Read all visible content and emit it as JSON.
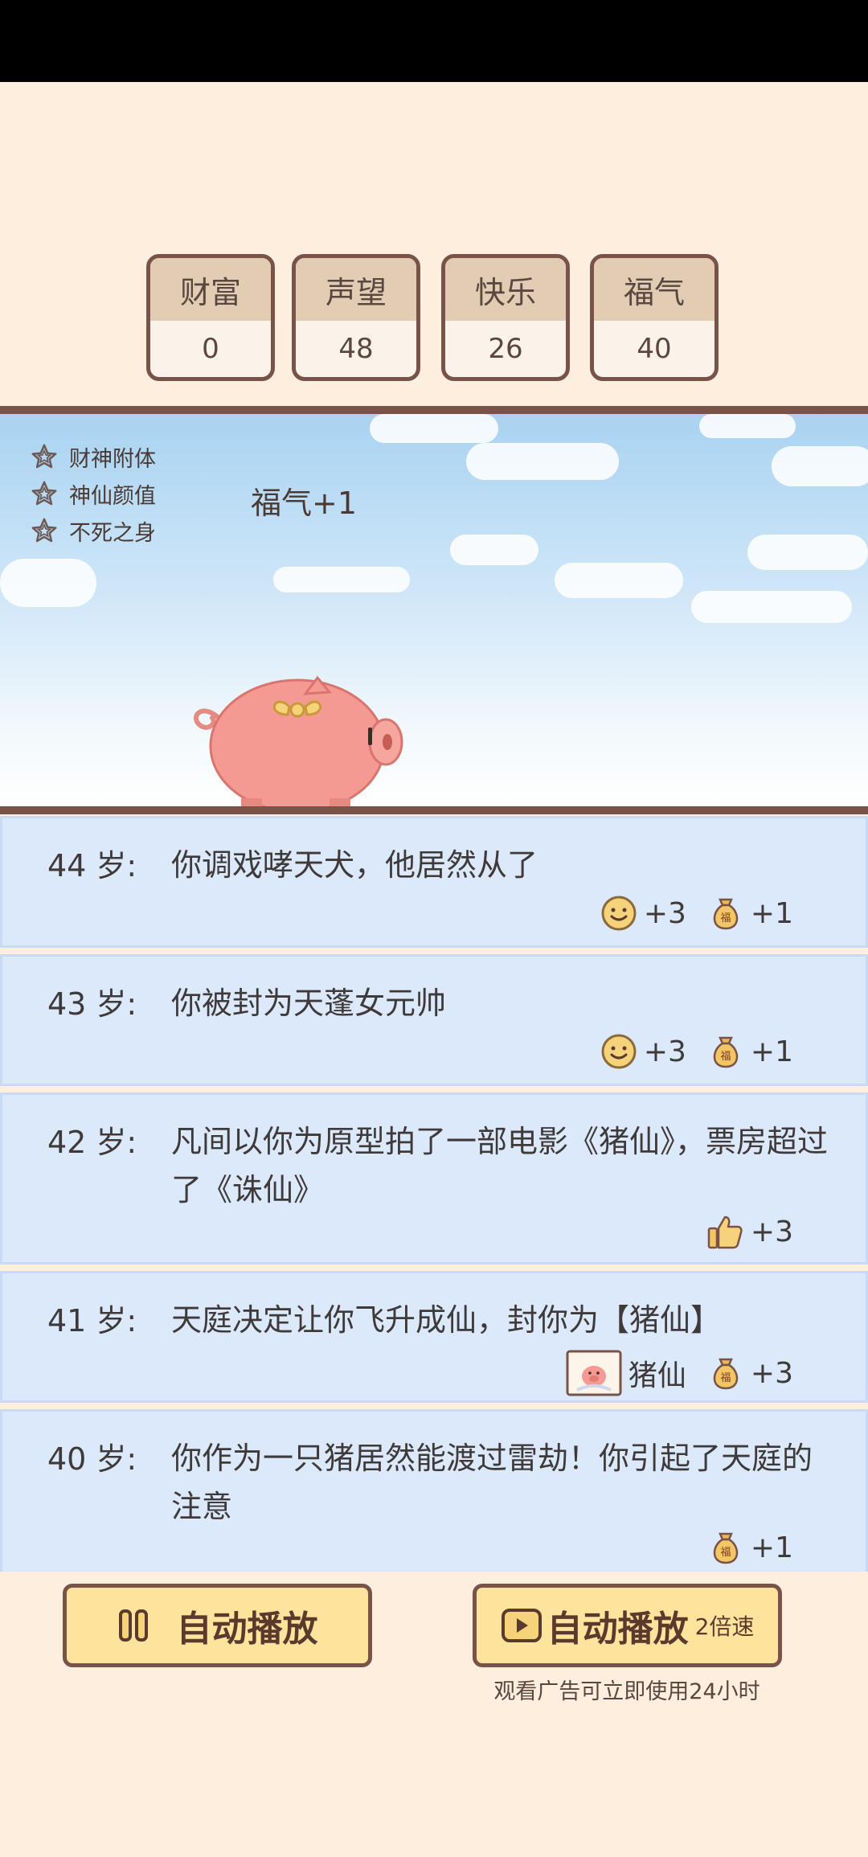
{
  "stats": [
    {
      "label": "财富",
      "value": "0"
    },
    {
      "label": "声望",
      "value": "48"
    },
    {
      "label": "快乐",
      "value": "26"
    },
    {
      "label": "福气",
      "value": "40"
    }
  ],
  "buffs": [
    "财神附体",
    "神仙颜值",
    "不死之身"
  ],
  "float_text": "福气+1",
  "log": [
    {
      "age": "44 岁:",
      "text": "你调戏哮天犬，他居然从了",
      "rewards": [
        {
          "icon": "smile-icon",
          "text": "+3"
        },
        {
          "icon": "fortune-bag-icon",
          "text": "+1"
        }
      ]
    },
    {
      "age": "43 岁:",
      "text": "你被封为天蓬女元帅",
      "rewards": [
        {
          "icon": "smile-icon",
          "text": "+3"
        },
        {
          "icon": "fortune-bag-icon",
          "text": "+1"
        }
      ]
    },
    {
      "age": "42 岁:",
      "text": "凡间以你为原型拍了一部电影《猪仙》，票房超过了《诛仙》",
      "rewards": [
        {
          "icon": "thumbs-up-icon",
          "text": "+3"
        }
      ]
    },
    {
      "age": "41 岁:",
      "text": "天庭决定让你飞升成仙，封你为【猪仙】",
      "rewards": [
        {
          "icon": "pig-avatar-icon",
          "text": "猪仙"
        },
        {
          "icon": "fortune-bag-icon",
          "text": "+3"
        }
      ]
    },
    {
      "age": "40 岁:",
      "text": "你作为一只猪居然能渡过雷劫！你引起了天庭的注意",
      "rewards": [
        {
          "icon": "fortune-bag-icon",
          "text": "+1"
        }
      ]
    }
  ],
  "buttons": {
    "auto_play": "自动播放",
    "auto_play_fast": "自动播放",
    "speed": "2倍速",
    "ad_note": "观看广告可立即使用24小时"
  }
}
